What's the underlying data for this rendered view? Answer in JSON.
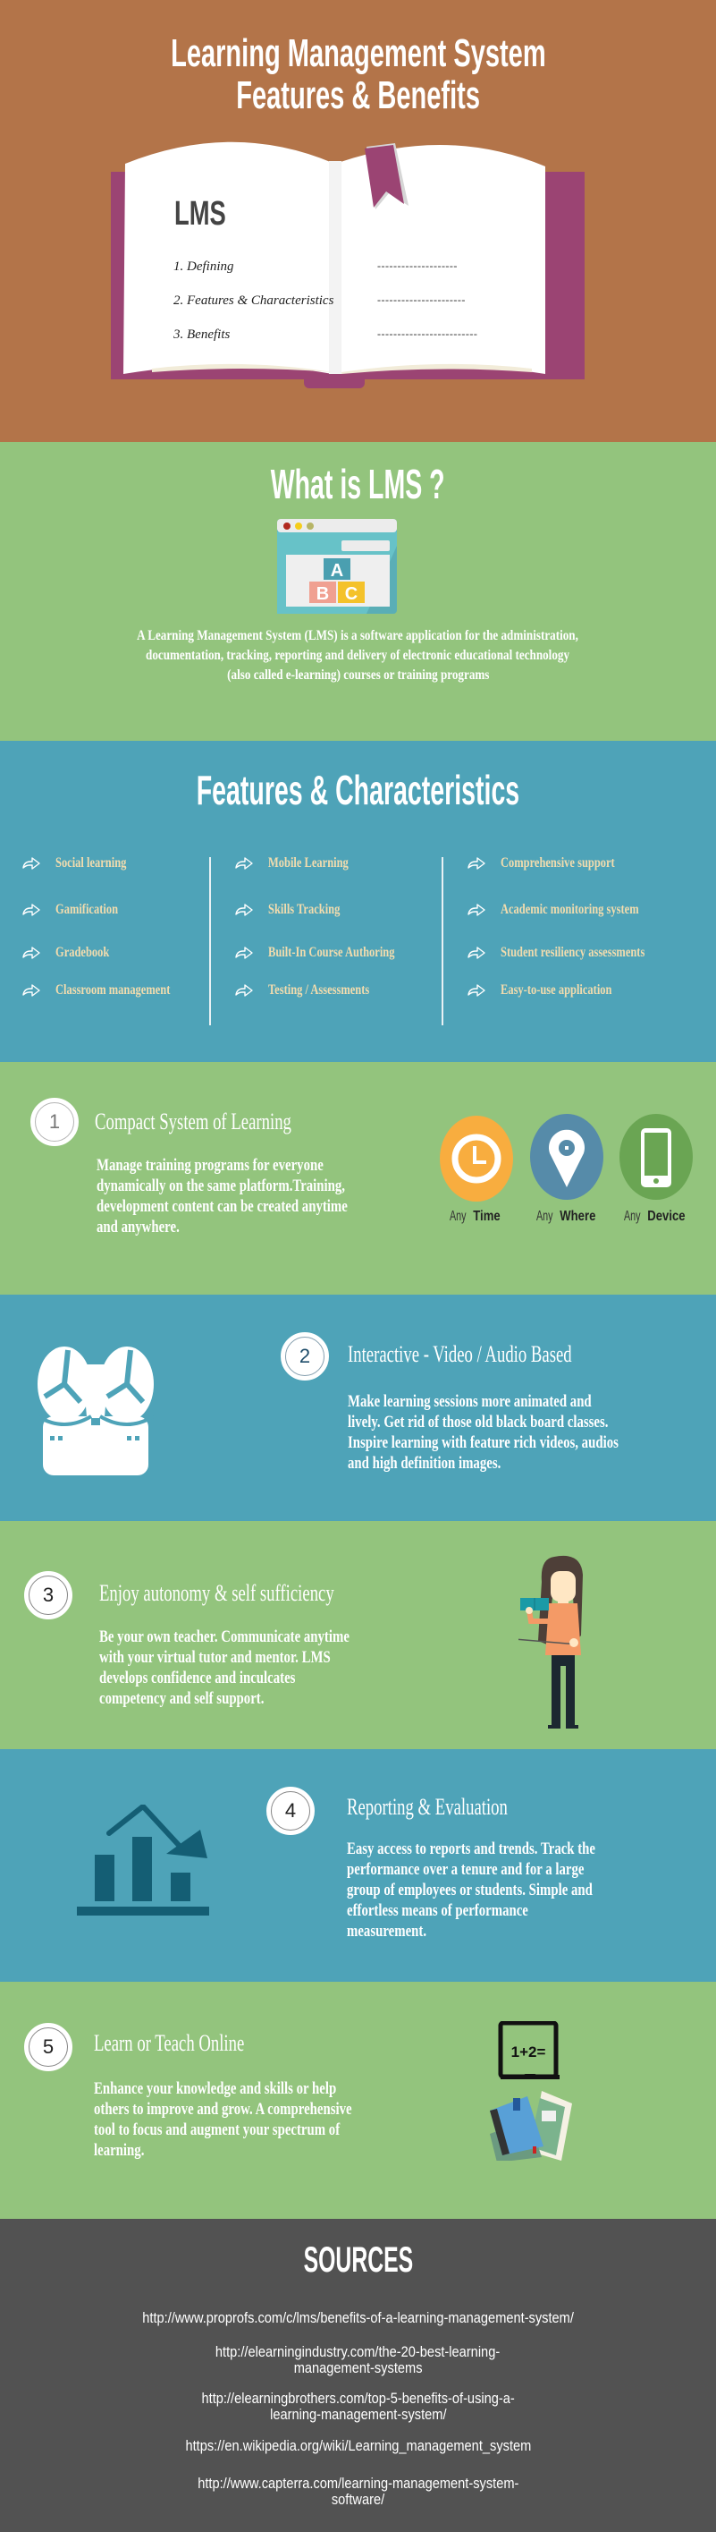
{
  "hero": {
    "title_line1": "Learning Management System",
    "title_line2": "Features & Benefits",
    "book": {
      "heading": "LMS",
      "toc": [
        {
          "label": "1. Defining",
          "dashes": "--------------------"
        },
        {
          "label": "2. Features & Characteristics",
          "dashes": "----------------------"
        },
        {
          "label": "3. Benefits",
          "dashes": "-------------------------"
        }
      ]
    }
  },
  "what_is": {
    "title": "What is LMS ?",
    "icon": "browser-abc-blocks-icon",
    "blocks": [
      "A",
      "B",
      "C"
    ],
    "description_lines": [
      "A Learning Management System (LMS) is a software application for the administration,",
      "documentation, tracking, reporting and delivery of electronic educational technology",
      "(also called e-learning) courses or training programs"
    ]
  },
  "features": {
    "title": "Features & Characteristics",
    "icon": "curved-arrow-right-icon",
    "columns": [
      [
        "Social learning",
        "Gamification",
        "Gradebook",
        "Classroom management"
      ],
      [
        "Mobile Learning",
        "Skills Tracking",
        "Built-In Course Authoring",
        "Testing / Assessments"
      ],
      [
        "Comprehensive support",
        "Academic monitoring system",
        "Student resiliency assessments",
        "Easy-to-use application"
      ]
    ]
  },
  "benefits": [
    {
      "number": "1",
      "title": "Compact System of Learning",
      "description_lines": [
        "Manage training programs for everyone",
        "dynamically on the same platform.Training,",
        "development content can be created anytime",
        "and anywhere."
      ],
      "badges": [
        {
          "prefix": "Any",
          "word": "Time",
          "icon": "clock-icon",
          "color": "#f8ad3f"
        },
        {
          "prefix": "Any",
          "word": "Where",
          "icon": "map-pin-icon",
          "color": "#568ba9"
        },
        {
          "prefix": "Any",
          "word": "Device",
          "icon": "smartphone-icon",
          "color": "#6aa553"
        }
      ]
    },
    {
      "number": "2",
      "title": "Interactive - Video / Audio Based",
      "description_lines": [
        "Make learning sessions more animated and",
        "lively. Get rid of those old black board classes.",
        "Inspire learning with feature rich videos, audios",
        "and high definition images."
      ],
      "icon": "reel-to-reel-recorder-icon"
    },
    {
      "number": "3",
      "title": "Enjoy autonomy & self sufficiency",
      "description_lines": [
        "Be your own teacher. Communicate anytime",
        "with your virtual tutor and mentor. LMS",
        "develops confidence and inculcates",
        "competency and self support."
      ],
      "icon": "teacher-woman-illustration"
    },
    {
      "number": "4",
      "title": "Reporting & Evaluation",
      "description_lines": [
        "Easy access to reports and trends. Track the",
        "performance over a tenure and for a large",
        "group of employees or students. Simple and",
        "effortless means of performance",
        "measurement."
      ],
      "icon": "bar-chart-trend-down-icon"
    },
    {
      "number": "5",
      "title": "Learn or Teach Online",
      "description_lines": [
        "Enhance your knowledge and skills or help",
        "others to improve and grow. A comprehensive",
        "tool to focus and augment your spectrum of",
        "learning."
      ],
      "icon": "laptop-books-icon",
      "screen_text": "1+2="
    }
  ],
  "sources": {
    "title": "SOURCES",
    "links": [
      [
        "http://www.proprofs.com/c/lms/benefits-of-a-learning-management-system/"
      ],
      [
        "http://elearningindustry.com/the-20-best-learning-",
        "management-systems"
      ],
      [
        "http://elearningbrothers.com/top-5-benefits-of-using-a-",
        "learning-management-system/"
      ],
      [
        "https://en.wikipedia.org/wiki/Learning_management_system"
      ],
      [
        "http://www.capterra.com/learning-management-system-",
        "software/"
      ]
    ]
  },
  "colors": {
    "hero_bg": "#b37449",
    "green_bg": "#93c47d",
    "blue_bg": "#4ea3b8",
    "sources_bg": "#525252",
    "book_cover": "#9b4473",
    "feature_text": "#f2dcae"
  }
}
